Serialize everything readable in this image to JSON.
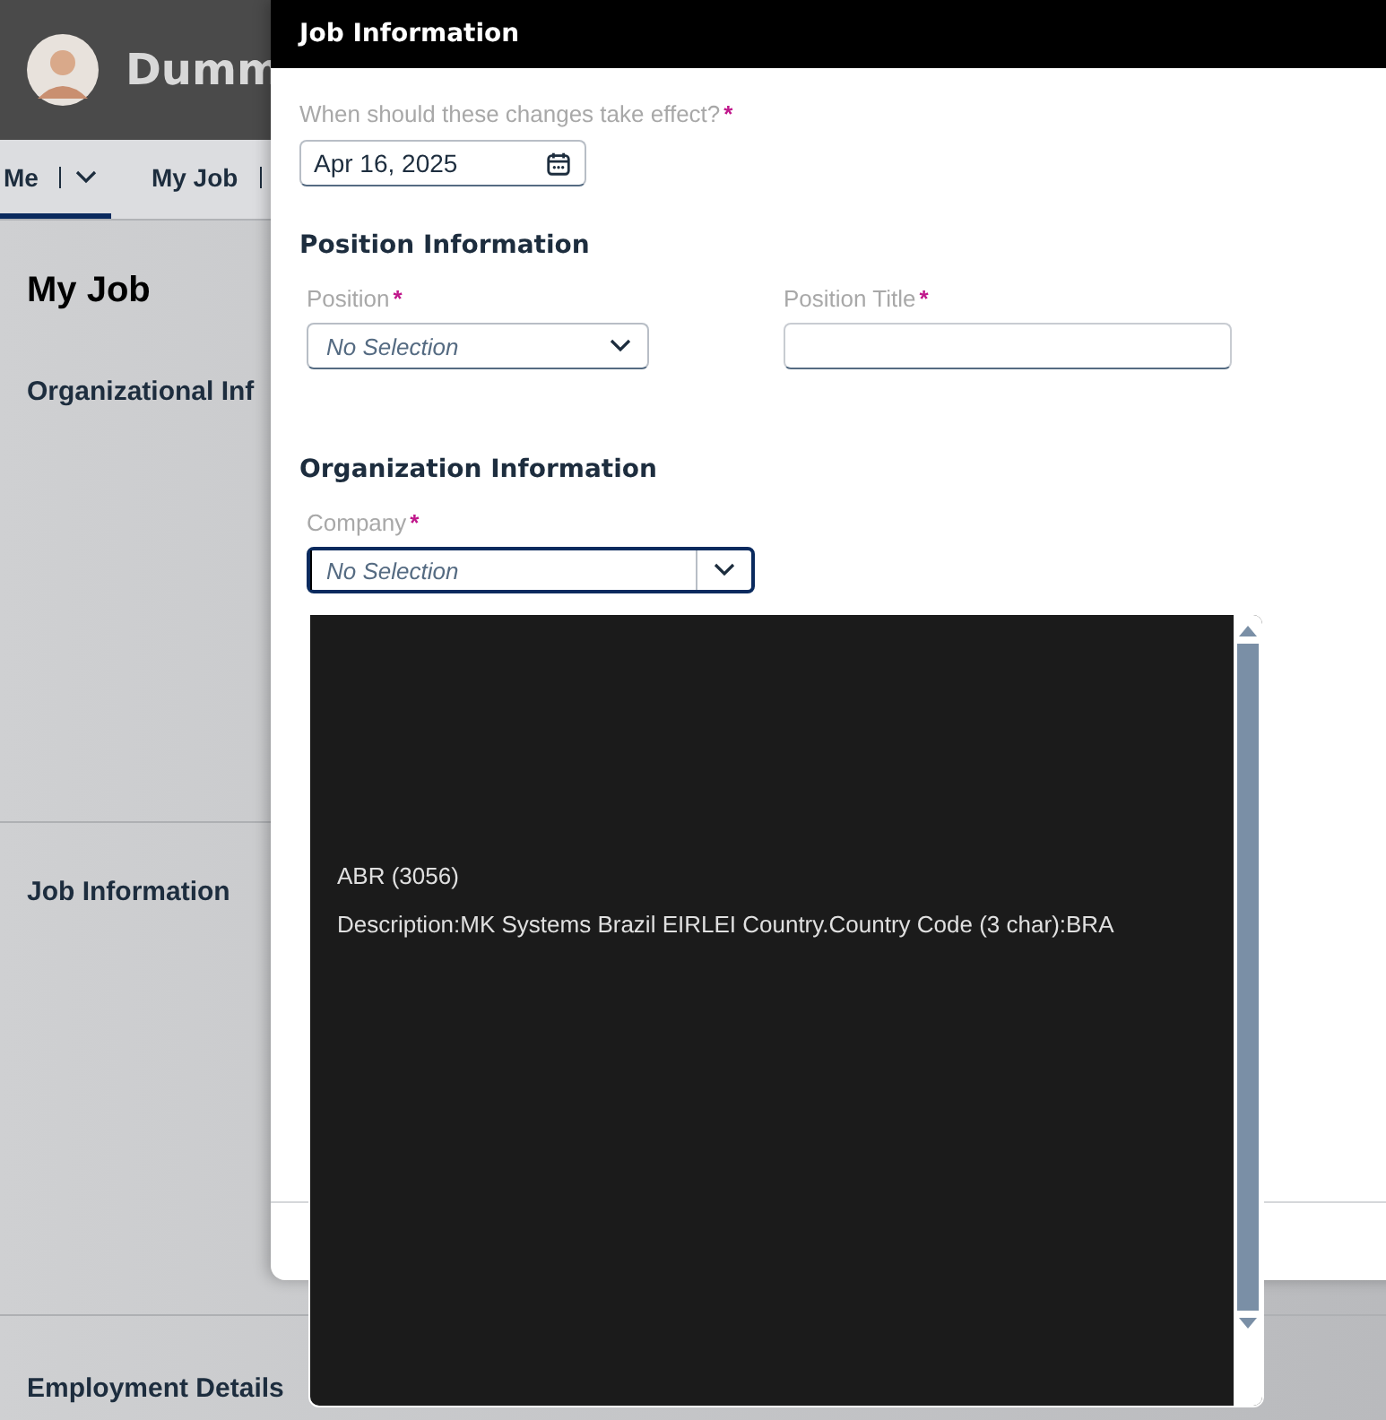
{
  "header": {
    "name": "Dumm"
  },
  "nav_tabs": [
    {
      "label": "Me",
      "selected": true,
      "has_menu": true
    },
    {
      "label": "My Job",
      "selected": false
    }
  ],
  "page": {
    "title": "My Job",
    "sections": [
      "Organizational Inf",
      "Job Information",
      "Employment Details"
    ]
  },
  "required_mark": "*",
  "dialog": {
    "title": "Job Information",
    "effective_date": {
      "label": "When should these changes take effect?",
      "required": true,
      "value": "Apr 16, 2025"
    },
    "groups": [
      {
        "title": "Position Information",
        "fields": [
          {
            "label": "Position",
            "required": true,
            "kind": "select",
            "value": "No Selection"
          },
          {
            "label": "Position Title",
            "required": true,
            "kind": "text"
          }
        ]
      },
      {
        "title": "Organization Information",
        "fields": [
          {
            "label": "Company",
            "required": true,
            "kind": "combobox",
            "value": "No Selection",
            "focused": true
          }
        ]
      }
    ]
  },
  "company_dropdown": {
    "options": [
      {
        "code": "ABR (3056)",
        "description": "Description:MK Systems Brazil EIRLEI Country.Country Code (3 char):BRA"
      }
    ]
  }
}
